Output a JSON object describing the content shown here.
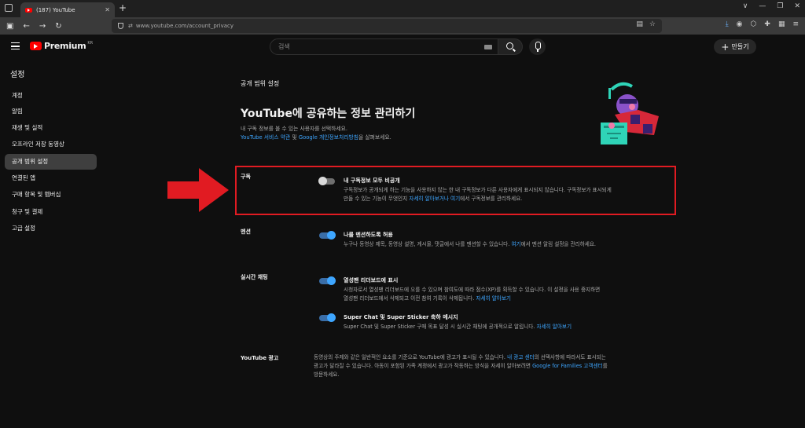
{
  "browser": {
    "tab_title": "(187) YouTube",
    "tab_close": "✕",
    "new_tab": "+",
    "url": "www.youtube.com/account_privacy",
    "nav": [
      "←",
      "→",
      "↻"
    ],
    "win_controls": [
      "∨",
      "—",
      "❐",
      "✕"
    ]
  },
  "header": {
    "logo_text": "Premium",
    "logo_region": "KR",
    "search_placeholder": "검색",
    "create_label": "만들기",
    "create_plus": "+"
  },
  "sidebar": {
    "title": "설정",
    "items": [
      {
        "label": "계정",
        "active": false
      },
      {
        "label": "알림",
        "active": false
      },
      {
        "label": "재생 및 실적",
        "active": false
      },
      {
        "label": "오프라인 저장 동영상",
        "active": false
      },
      {
        "label": "공개 범위 설정",
        "active": true
      },
      {
        "label": "연결된 앱",
        "active": false
      },
      {
        "label": "구매 항목 및 멤버십",
        "active": false
      },
      {
        "label": "청구 및 결제",
        "active": false
      },
      {
        "label": "고급 설정",
        "active": false
      }
    ]
  },
  "main": {
    "section_label": "공개 범위 설정",
    "heading": "YouTube에 공유하는 정보 관리하기",
    "desc_line1": "내 구독 정보를 볼 수 있는 사용자를 선택하세요.",
    "desc_link1": "YouTube 서비스 약관",
    "desc_mid": " 및 ",
    "desc_link2": "Google 개인정보처리방침",
    "desc_end": "을 살펴보세요.",
    "subscriptions": {
      "label": "구독",
      "toggle_on": false,
      "title": "내 구독정보 모두 비공개",
      "desc_a": "구독정보가 공개되게 하는 기능을 사용하지 않는 한 내 구독정보가 다른 사용자에게 표시되지 않습니다. 구독정보가 표시되게",
      "desc_b": "만들 수 있는 기능이 무엇인지 ",
      "link_a": "자세히 알아보거나",
      "mid": " ",
      "link_b": "여기",
      "desc_c": "에서 구독정보를 관리하세요."
    },
    "mentions": {
      "label": "멘션",
      "toggle_on": true,
      "title": "나를 멘션하도록 허용",
      "desc_a": "누구나 동영상 제목, 동영상 설명, 게시물, 댓글에서 나를 멘션할 수 있습니다. ",
      "link": "여기",
      "desc_b": "에서 멘션 알림 설정을 관리하세요."
    },
    "live_chat": {
      "label": "실시간 채팅",
      "leaderboard": {
        "toggle_on": true,
        "title": "열성팬 리더보드에 표시",
        "desc_a": "시청자로서 열성팬 리더보드에 오를 수 있으며 참여도에 따라 점수(XP)를 획득할 수 있습니다. 이 설정을 사용 중지하면",
        "desc_b": "열성팬 리더보드에서 삭제되고 이전 참여 기록이 삭제됩니다. ",
        "link": "자세히 알아보기"
      },
      "superchat": {
        "toggle_on": true,
        "title": "Super Chat 및 Super Sticker 축하 메시지",
        "desc": "Super Chat 및 Super Sticker 구매 목표 달성 시 실시간 채팅에 공개적으로 알립니다. ",
        "link": "자세히 알아보기"
      }
    },
    "ads": {
      "label": "YouTube 광고",
      "desc_a": "동영상의 주제와 같은 일반적인 요소를 기준으로 YouTube에 광고가 표시될 수 있습니다. ",
      "link_a": "내 광고 센터",
      "desc_b": "의 선택사항에 따라서도 표시되는",
      "desc_c": "광고가 달라질 수 있습니다. 아동이 포함된 가족 계정에서 광고가 작동하는 방식을 자세히 알아보려면 ",
      "link_b": "Google for Families 고객센터",
      "desc_d": "를",
      "desc_e": "방문하세요."
    }
  },
  "colors": {
    "annotation_red": "#e11b22",
    "link_blue": "#3ea6ff",
    "toggle_on": "#3ea6ff"
  }
}
